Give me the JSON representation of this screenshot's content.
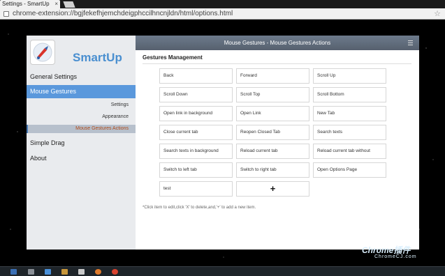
{
  "browser": {
    "tab_title": "Settings - SmartUp",
    "url": "chrome-extension://bgjfekefhjemchdeigphccilhncnjldn/html/options.html"
  },
  "window": {
    "title": "Mouse Gestures - Mouse Gestures Actions"
  },
  "sidebar": {
    "brand": "SmartUp",
    "items": [
      {
        "label": "General Settings"
      },
      {
        "label": "Mouse Gestures"
      },
      {
        "label": "Settings"
      },
      {
        "label": "Appearance"
      },
      {
        "label": "Mouse Gestures Actions"
      },
      {
        "label": "Simple Drag"
      },
      {
        "label": "About"
      }
    ]
  },
  "main": {
    "section_title": "Gestures Management",
    "actions": [
      "Back",
      "Forward",
      "Scroll Up",
      "Scroll Down",
      "Scroll Top",
      "Scroll Bottom",
      "Open link in background",
      "Open Link",
      "New Tab",
      "Close current tab",
      "Reopen Closed Tab",
      "Search texts",
      "Search texts in background",
      "Reload current tab",
      "Reload current tab without",
      "Switch to left tab",
      "Switch to right tab",
      "Open Options Page",
      "test"
    ],
    "add_symbol": "+",
    "hint": "*Click item to edit,click 'X' to delete,and,'+' to add a new item."
  },
  "watermark": {
    "title": "Chrome插件",
    "subtitle": "ChromeCJ.com"
  },
  "colors": {
    "accent": "#5a98dc",
    "brand": "#4a8fd0",
    "active_sub": "#b04a18",
    "titlebar": "#5f6a78"
  }
}
